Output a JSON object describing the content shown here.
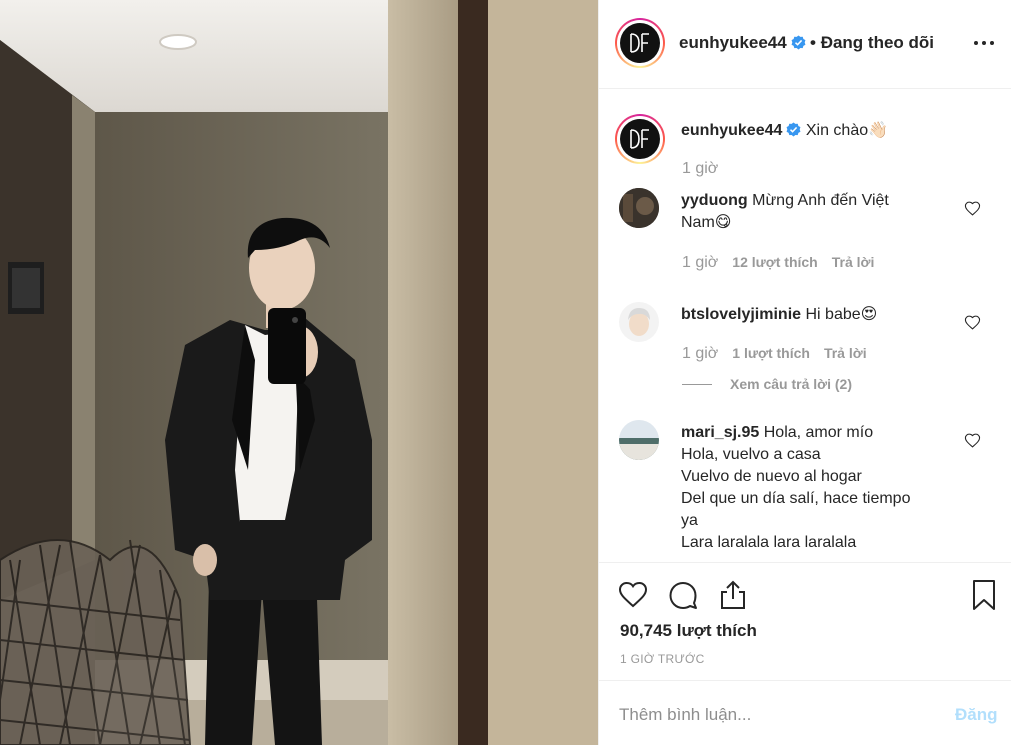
{
  "post": {
    "username": "eunhyukee44",
    "verified": true,
    "follow_separator": "•",
    "follow_state": "Đang theo dõi",
    "avatar_monogram": "DE"
  },
  "caption": {
    "username": "eunhyukee44",
    "text": "Xin chào👋🏻",
    "time": "1 giờ"
  },
  "comments": [
    {
      "username": "yyduong",
      "lines": [
        "Mừng Anh đến Việt",
        "Nam😋"
      ],
      "time": "1 giờ",
      "likes": "12 lượt thích",
      "reply": "Trả lời"
    },
    {
      "username": "btslovelyjiminie",
      "lines": [
        "Hi babe😍"
      ],
      "time": "1 giờ",
      "likes": "1 lượt thích",
      "reply": "Trả lời",
      "view_replies": "Xem câu trả lời (2)"
    },
    {
      "username": "mari_sj.95",
      "lines": [
        "Hola, amor mío",
        "Hola, vuelvo a casa",
        "Vuelvo de nuevo al hogar",
        "Del que un día salí, hace tiempo",
        "ya",
        "Lara laralala lara laralala"
      ]
    }
  ],
  "actions": {
    "like_icon": "heart-icon",
    "comment_icon": "comment-icon",
    "share_icon": "share-icon",
    "save_icon": "bookmark-icon",
    "likes_count": "90,745 lượt thích",
    "time_ago": "1 GIỜ TRƯỚC"
  },
  "composer": {
    "placeholder": "Thêm bình luận...",
    "post_label": "Đăng"
  },
  "colors": {
    "verified": "#3897f0",
    "muted": "#999999",
    "post_disabled": "#b2dffc"
  }
}
